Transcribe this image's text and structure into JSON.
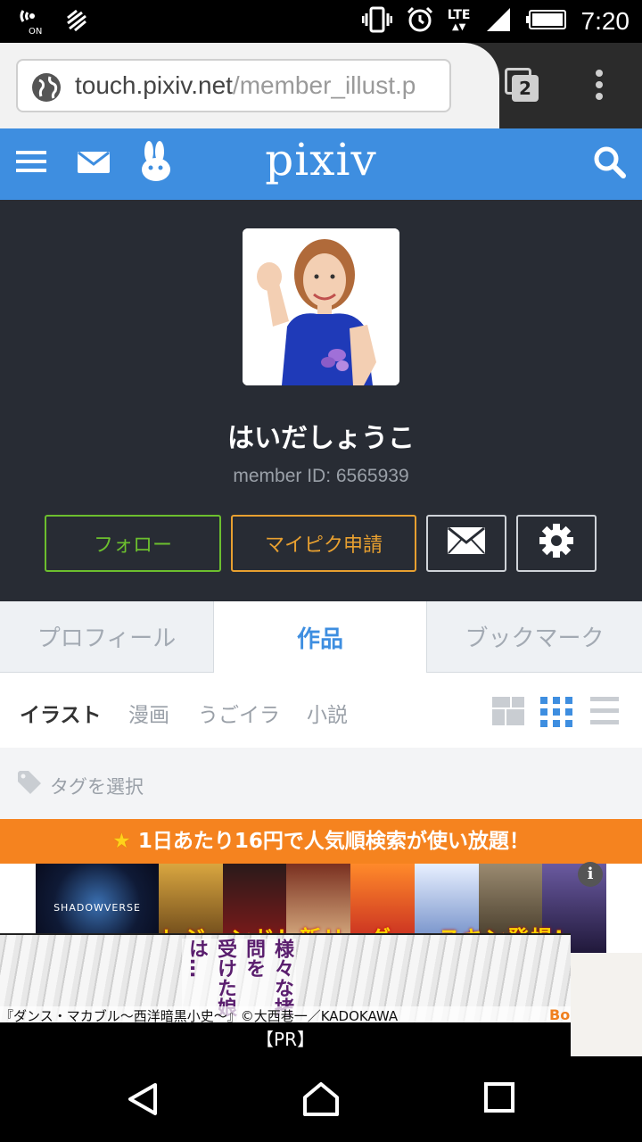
{
  "status_bar": {
    "time": "7:20",
    "network": "LTE",
    "nfc_label": "ON"
  },
  "browser": {
    "url_domain": "touch.pixiv.net",
    "url_path": "/member_illust.p",
    "tab_count": "2"
  },
  "header": {
    "logo": "pixiv"
  },
  "profile": {
    "username": "はいだしょうこ",
    "member_id": "member ID: 6565939",
    "follow_label": "フォロー",
    "mypixiv_label": "マイピク申請"
  },
  "tabs": [
    {
      "label": "プロフィール",
      "active": false
    },
    {
      "label": "作品",
      "active": true
    },
    {
      "label": "ブックマーク",
      "active": false
    }
  ],
  "categories": [
    {
      "label": "イラスト",
      "active": true
    },
    {
      "label": "漫画",
      "active": false
    },
    {
      "label": "うごイラ",
      "active": false
    },
    {
      "label": "小説",
      "active": false
    }
  ],
  "tag_filter": {
    "label": "タグを選択"
  },
  "promo": {
    "icon": "star-icon",
    "text": "1日あたり16円で人気順検索が使い放題！"
  },
  "ads": {
    "banner1_brand": "SHADOWVERSE",
    "banner1_ribbon": "レジェンド！新リーダー・スキン登場!",
    "banner2_text_a": "様々な拷問を",
    "banner2_text_b": "受けた娘は…",
    "banner2_credit": "『ダンス・マカブル～西洋暗黒小史～』©大西巷一／KADOKAWA",
    "banner2_corner": "Bo",
    "pr_label": "【PR】"
  },
  "colors": {
    "header_blue": "#3e8ee0",
    "profile_dark": "#282c34",
    "follow_green": "#6cbf2e",
    "mypixiv_orange": "#e8a030",
    "promo_orange": "#f5831f"
  }
}
